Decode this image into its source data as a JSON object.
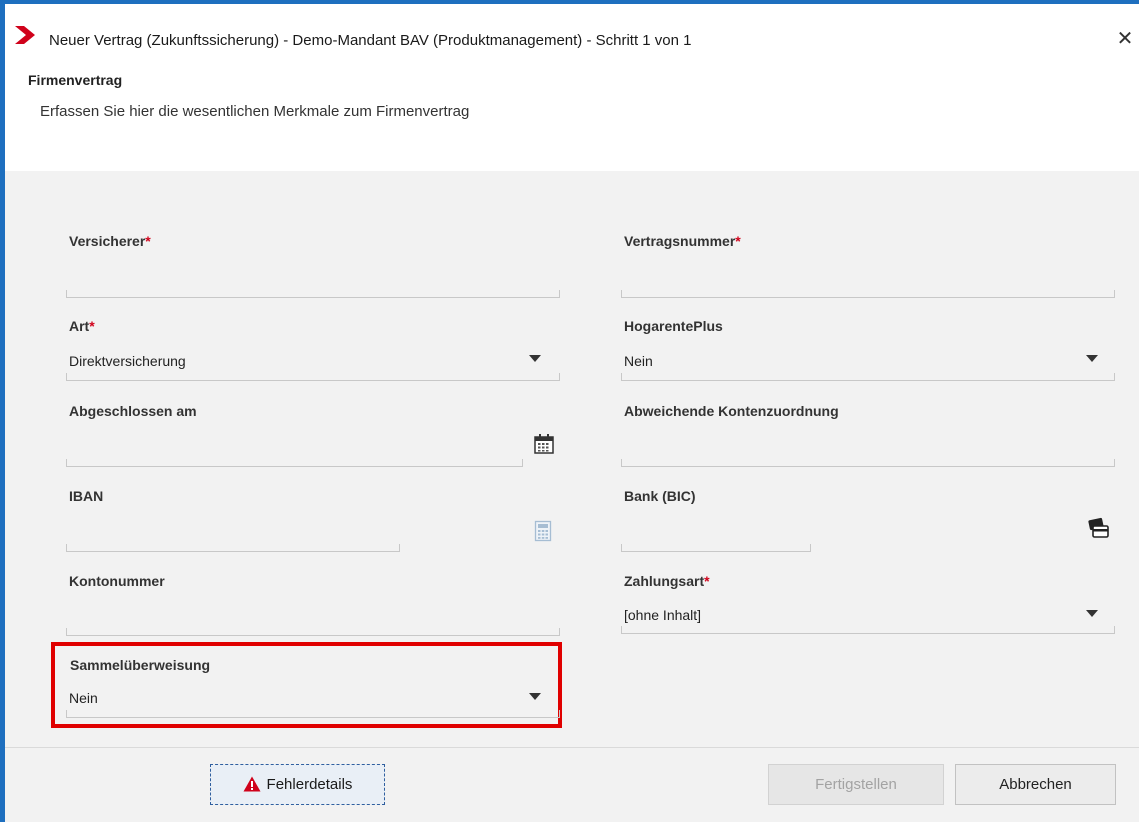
{
  "window": {
    "title": "Neuer Vertrag (Zukunftssicherung) - Demo-Mandant BAV (Produktmanagement) - Schritt 1 von 1",
    "close_glyph": "✕",
    "accent_color": "#1e6fbf",
    "logo_color": "#d0021b"
  },
  "section": {
    "title": "Firmenvertrag",
    "description": "Erfassen Sie hier die wesentlichen Merkmale zum Firmenvertrag"
  },
  "required_marker": "*",
  "fields": {
    "versicherer": {
      "label": "Versicherer",
      "required": true,
      "value": ""
    },
    "vertragsnummer": {
      "label": "Vertragsnummer",
      "required": true,
      "value": ""
    },
    "art": {
      "label": "Art",
      "required": true,
      "value": "Direktversicherung"
    },
    "hogarenteplus": {
      "label": "HogarentePlus",
      "required": false,
      "value": "Nein"
    },
    "abgeschlossen_am": {
      "label": "Abgeschlossen am",
      "required": false,
      "value": "",
      "icon": "calendar-icon"
    },
    "abweichende_kontenzuordnung": {
      "label": "Abweichende Kontenzuordnung",
      "required": false,
      "value": ""
    },
    "iban": {
      "label": "IBAN",
      "required": false,
      "value": "",
      "icon": "calculator-icon"
    },
    "bank_bic": {
      "label": "Bank (BIC)",
      "required": false,
      "value": "",
      "icon": "bank-cards-icon"
    },
    "kontonummer": {
      "label": "Kontonummer",
      "required": false,
      "value": ""
    },
    "zahlungsart": {
      "label": "Zahlungsart",
      "required": true,
      "value": "[ohne Inhalt]"
    },
    "sammelueberweisung": {
      "label": "Sammelüberweisung",
      "required": false,
      "value": "Nein",
      "highlight_color": "#e00000"
    }
  },
  "buttons": {
    "fehlerdetails": {
      "label": "Fehlerdetails",
      "icon": "warning-icon"
    },
    "fertigstellen": {
      "label": "Fertigstellen",
      "enabled": false
    },
    "abbrechen": {
      "label": "Abbrechen"
    }
  }
}
